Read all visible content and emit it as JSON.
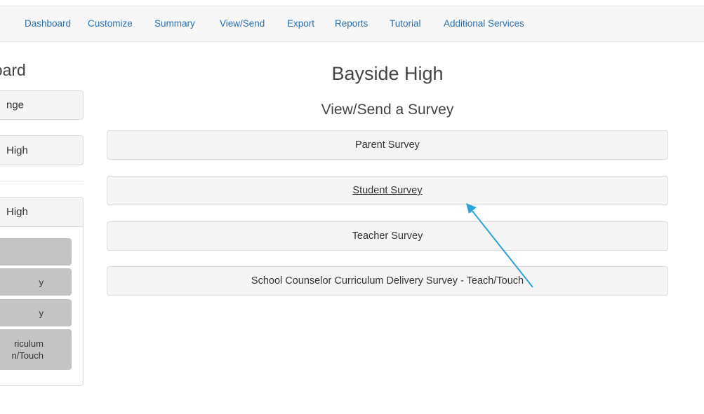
{
  "nav": {
    "items": [
      "Dashboard",
      "Customize",
      "Summary",
      "View/Send",
      "Export",
      "Reports",
      "Tutorial",
      "Additional Services"
    ]
  },
  "sidebar": {
    "title": "board",
    "change_button": "nge",
    "school_button": "High",
    "panel_header": "High",
    "survey_items": [
      "",
      "y",
      "y",
      "riculum\nn/Touch"
    ]
  },
  "main": {
    "school_name": "Bayside High",
    "page_subtitle": "View/Send a Survey",
    "surveys": [
      "Parent Survey",
      "Student Survey",
      "Teacher Survey",
      "School Counselor Curriculum Delivery Survey - Teach/Touch"
    ]
  },
  "annotation": {
    "arrow_color": "#29a3dc"
  }
}
